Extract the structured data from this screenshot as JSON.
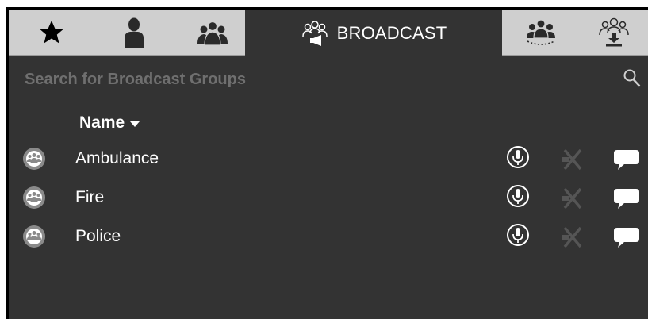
{
  "tabs": [
    {
      "icon": "star-icon"
    },
    {
      "icon": "person-icon"
    },
    {
      "icon": "group-icon"
    },
    {
      "icon": "broadcast-icon",
      "label": "BROADCAST",
      "active": true
    },
    {
      "icon": "conference-icon"
    },
    {
      "icon": "group-download-icon"
    }
  ],
  "search": {
    "placeholder": "Search for Broadcast Groups",
    "value": ""
  },
  "list": {
    "column_header": "Name",
    "sort_icon": "caret-down-icon",
    "rows": [
      {
        "name": "Ambulance",
        "icon": "group-avatar-icon"
      },
      {
        "name": "Fire",
        "icon": "group-avatar-icon"
      },
      {
        "name": "Police",
        "icon": "group-avatar-icon"
      }
    ],
    "row_actions": [
      "microphone-icon",
      "mute-icon",
      "chat-icon"
    ]
  },
  "colors": {
    "background": "#333333",
    "tabbar": "#cfcfcf",
    "text": "#ffffff",
    "placeholder": "#6f6f6f"
  }
}
